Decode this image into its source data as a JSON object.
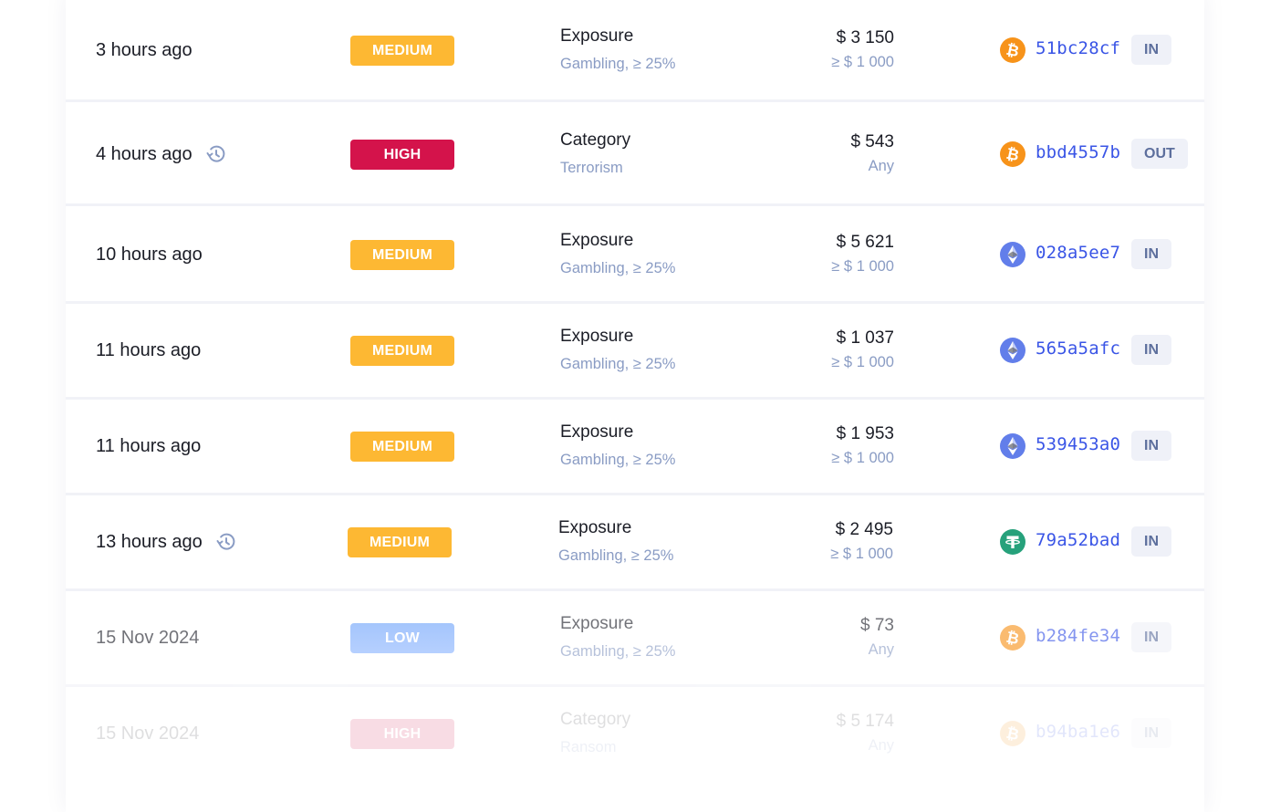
{
  "colors": {
    "medium": "#fdb833",
    "high": "#d4134b",
    "low": "#6ea3fb",
    "hash": "#3a55e6",
    "muted": "#8a9cc4",
    "btc": "#f7931a",
    "eth": "#627eea",
    "usdt": "#26a17b"
  },
  "alerts": [
    {
      "time": "3 hours ago",
      "history": false,
      "severity": "MEDIUM",
      "severity_key": "medium",
      "rule": "Exposure",
      "rule_detail": "Gambling, ≥ 25%",
      "amount": "$ 3 150",
      "threshold": "≥ $ 1 000",
      "coin": "btc-icon",
      "hash": "51bc28cf",
      "direction": "IN"
    },
    {
      "time": "4 hours ago",
      "history": true,
      "severity": "HIGH",
      "severity_key": "high",
      "rule": "Category",
      "rule_detail": "Terrorism",
      "amount": "$ 543",
      "threshold": "Any",
      "coin": "btc-icon",
      "hash": "bbd4557b",
      "direction": "OUT"
    },
    {
      "time": "10 hours ago",
      "history": false,
      "severity": "MEDIUM",
      "severity_key": "medium",
      "rule": "Exposure",
      "rule_detail": "Gambling, ≥ 25%",
      "amount": "$ 5 621",
      "threshold": "≥ $ 1 000",
      "coin": "eth-icon",
      "hash": "028a5ee7",
      "direction": "IN"
    },
    {
      "time": "11 hours ago",
      "history": false,
      "severity": "MEDIUM",
      "severity_key": "medium",
      "rule": "Exposure",
      "rule_detail": "Gambling, ≥ 25%",
      "amount": "$ 1 037",
      "threshold": "≥ $ 1 000",
      "coin": "eth-icon",
      "hash": "565a5afc",
      "direction": "IN"
    },
    {
      "time": "11 hours ago",
      "history": false,
      "severity": "MEDIUM",
      "severity_key": "medium",
      "rule": "Exposure",
      "rule_detail": "Gambling, ≥ 25%",
      "amount": "$ 1 953",
      "threshold": "≥ $ 1 000",
      "coin": "eth-icon",
      "hash": "539453a0",
      "direction": "IN"
    },
    {
      "time": "13 hours ago",
      "history": true,
      "severity": "MEDIUM",
      "severity_key": "medium",
      "rule": "Exposure",
      "rule_detail": "Gambling, ≥ 25%",
      "amount": "$ 2 495",
      "threshold": "≥ $ 1 000",
      "coin": "usdt-icon",
      "hash": "79a52bad",
      "direction": "IN"
    },
    {
      "time": "15 Nov 2024",
      "history": false,
      "severity": "LOW",
      "severity_key": "low",
      "rule": "Exposure",
      "rule_detail": "Gambling, ≥ 25%",
      "amount": "$ 73",
      "threshold": "Any",
      "coin": "btc-icon",
      "hash": "b284fe34",
      "direction": "IN"
    },
    {
      "time": "15 Nov 2024",
      "history": false,
      "severity": "HIGH",
      "severity_key": "high",
      "rule": "Category",
      "rule_detail": "Ransom",
      "amount": "$ 5 174",
      "threshold": "Any",
      "coin": "btc-icon",
      "hash": "b94ba1e6",
      "direction": "IN"
    }
  ]
}
